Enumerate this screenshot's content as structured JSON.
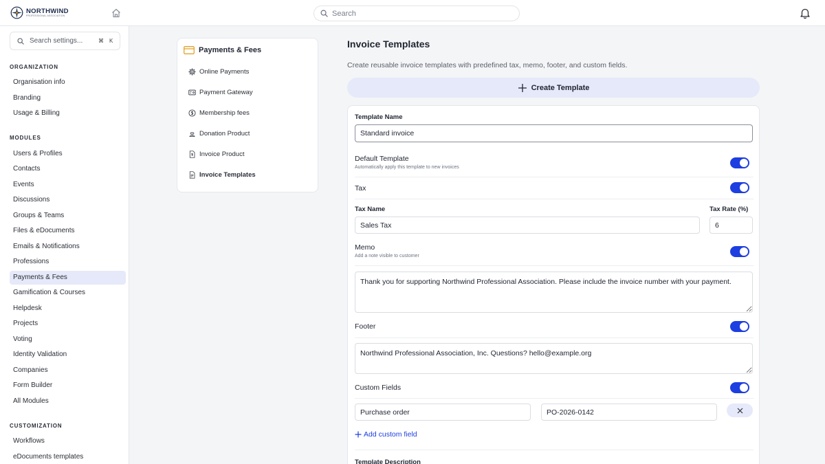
{
  "brand": {
    "name": "NORTHWIND",
    "subtitle": "PROFESSIONAL ASSOCIATION"
  },
  "topbar": {
    "search_placeholder": "Search"
  },
  "sidebar": {
    "search_placeholder": "Search settings...",
    "shortcut_keys": [
      "⌘",
      "K"
    ],
    "sections": [
      {
        "heading": "ORGANIZATION",
        "items": [
          "Organisation info",
          "Branding",
          "Usage & Billing"
        ]
      },
      {
        "heading": "MODULES",
        "items": [
          "Users & Profiles",
          "Contacts",
          "Events",
          "Discussions",
          "Groups & Teams",
          "Files & eDocuments",
          "Emails & Notifications",
          "Professions",
          "Payments & Fees",
          "Gamification & Courses",
          "Helpdesk",
          "Projects",
          "Voting",
          "Identity Validation",
          "Companies",
          "Form Builder",
          "All Modules"
        ]
      },
      {
        "heading": "CUSTOMIZATION",
        "items": [
          "Workflows",
          "eDocuments templates"
        ]
      }
    ],
    "active_item": "Payments & Fees"
  },
  "subnav": {
    "title": "Payments & Fees",
    "items": [
      {
        "label": "Online Payments",
        "icon": "gear-icon"
      },
      {
        "label": "Payment Gateway",
        "icon": "card-icon"
      },
      {
        "label": "Membership fees",
        "icon": "dollar-circle-icon"
      },
      {
        "label": "Donation Product",
        "icon": "hand-heart-icon"
      },
      {
        "label": "Invoice Product",
        "icon": "invoice-dollar-icon"
      },
      {
        "label": "Invoice Templates",
        "icon": "document-icon"
      }
    ],
    "active_item": "Invoice Templates"
  },
  "main": {
    "title": "Invoice Templates",
    "description": "Create reusable invoice templates with predefined tax, memo, footer, and custom fields.",
    "create_button": "Create Template"
  },
  "form": {
    "template_name_label": "Template Name",
    "template_name_value": "Standard invoice",
    "default_template": {
      "label": "Default Template",
      "hint": "Automatically apply this template to new invoices",
      "enabled": true
    },
    "tax": {
      "label": "Tax",
      "enabled": true,
      "name_label": "Tax Name",
      "name_value": "Sales Tax",
      "rate_label": "Tax Rate (%)",
      "rate_value": "6"
    },
    "memo": {
      "label": "Memo",
      "hint": "Add a note visible to customer",
      "enabled": true,
      "value": "Thank you for supporting Northwind Professional Association. Please include the invoice number with your payment."
    },
    "footer": {
      "label": "Footer",
      "enabled": true,
      "value": "Northwind Professional Association, Inc. Questions? hello@example.org"
    },
    "custom_fields": {
      "label": "Custom Fields",
      "enabled": true,
      "rows": [
        {
          "key": "Purchase order",
          "value": "PO-2026-0142"
        }
      ],
      "add_label": "Add custom field"
    },
    "description_label": "Template Description"
  },
  "colors": {
    "accent": "#1d3ee0",
    "active_bg": "#e6e9f9",
    "button_bg": "#e5e9fa",
    "icon_gold": "#e3a32b"
  }
}
